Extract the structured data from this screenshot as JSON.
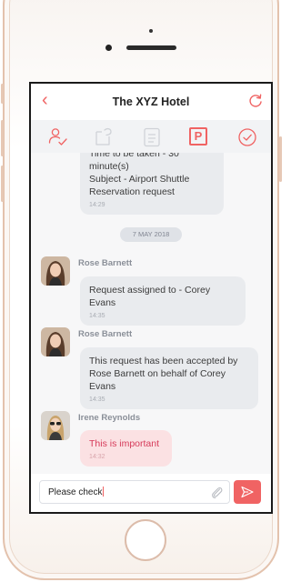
{
  "header": {
    "title": "The XYZ Hotel"
  },
  "toolbar": {
    "tools": [
      "assign-user-icon",
      "handoff-icon",
      "notes-icon",
      "parking-icon",
      "check-circle-icon"
    ],
    "parking_label": "P"
  },
  "messages": {
    "top_partial": {
      "lines": [
        "Time to be taken - 30 minute(s)",
        "Subject - Airport Shuttle",
        "Reservation request"
      ],
      "time": "14:29"
    },
    "date_separator": "7 MAY 2018",
    "items": [
      {
        "sender": "Rose Barnett",
        "lines": [
          "Request assigned to - Corey Evans"
        ],
        "time": "14:35"
      },
      {
        "sender": "Rose Barnett",
        "lines": [
          "This request has been accepted by",
          "Rose Barnett on behalf of Corey Evans"
        ],
        "time": "14:35"
      },
      {
        "sender": "Irene Reynolds",
        "lines": [
          "This is important"
        ],
        "time": "14:32",
        "important": true
      }
    ]
  },
  "composer": {
    "value": "Please check"
  },
  "colors": {
    "accent": "#f06363",
    "bubble": "#e9ebee",
    "important_bubble": "#fbe1e3",
    "important_text": "#d63b5a"
  }
}
